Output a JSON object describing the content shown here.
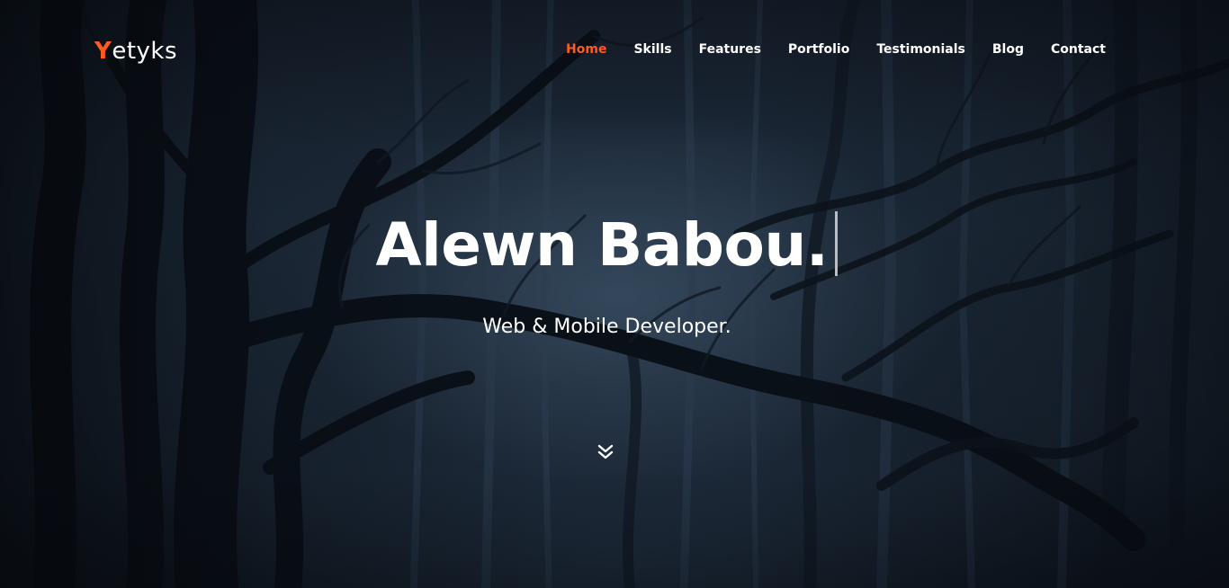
{
  "brand": {
    "initial": "Y",
    "rest": "etyks",
    "accent_color": "#ff5a1f"
  },
  "nav": {
    "items": [
      {
        "label": "Home",
        "active": true
      },
      {
        "label": "Skills",
        "active": false
      },
      {
        "label": "Features",
        "active": false
      },
      {
        "label": "Portfolio",
        "active": false
      },
      {
        "label": "Testimonials",
        "active": false
      },
      {
        "label": "Blog",
        "active": false
      },
      {
        "label": "Contact",
        "active": false
      }
    ]
  },
  "hero": {
    "title": "Alewn Babou.",
    "subtitle": "Web & Mobile Developer.",
    "scroll_icon": "double-chevron-down-icon",
    "background": "dark-forest-photo"
  },
  "colors": {
    "text": "#ffffff",
    "accent": "#ff5a1f",
    "overlay": "#0f1620"
  }
}
